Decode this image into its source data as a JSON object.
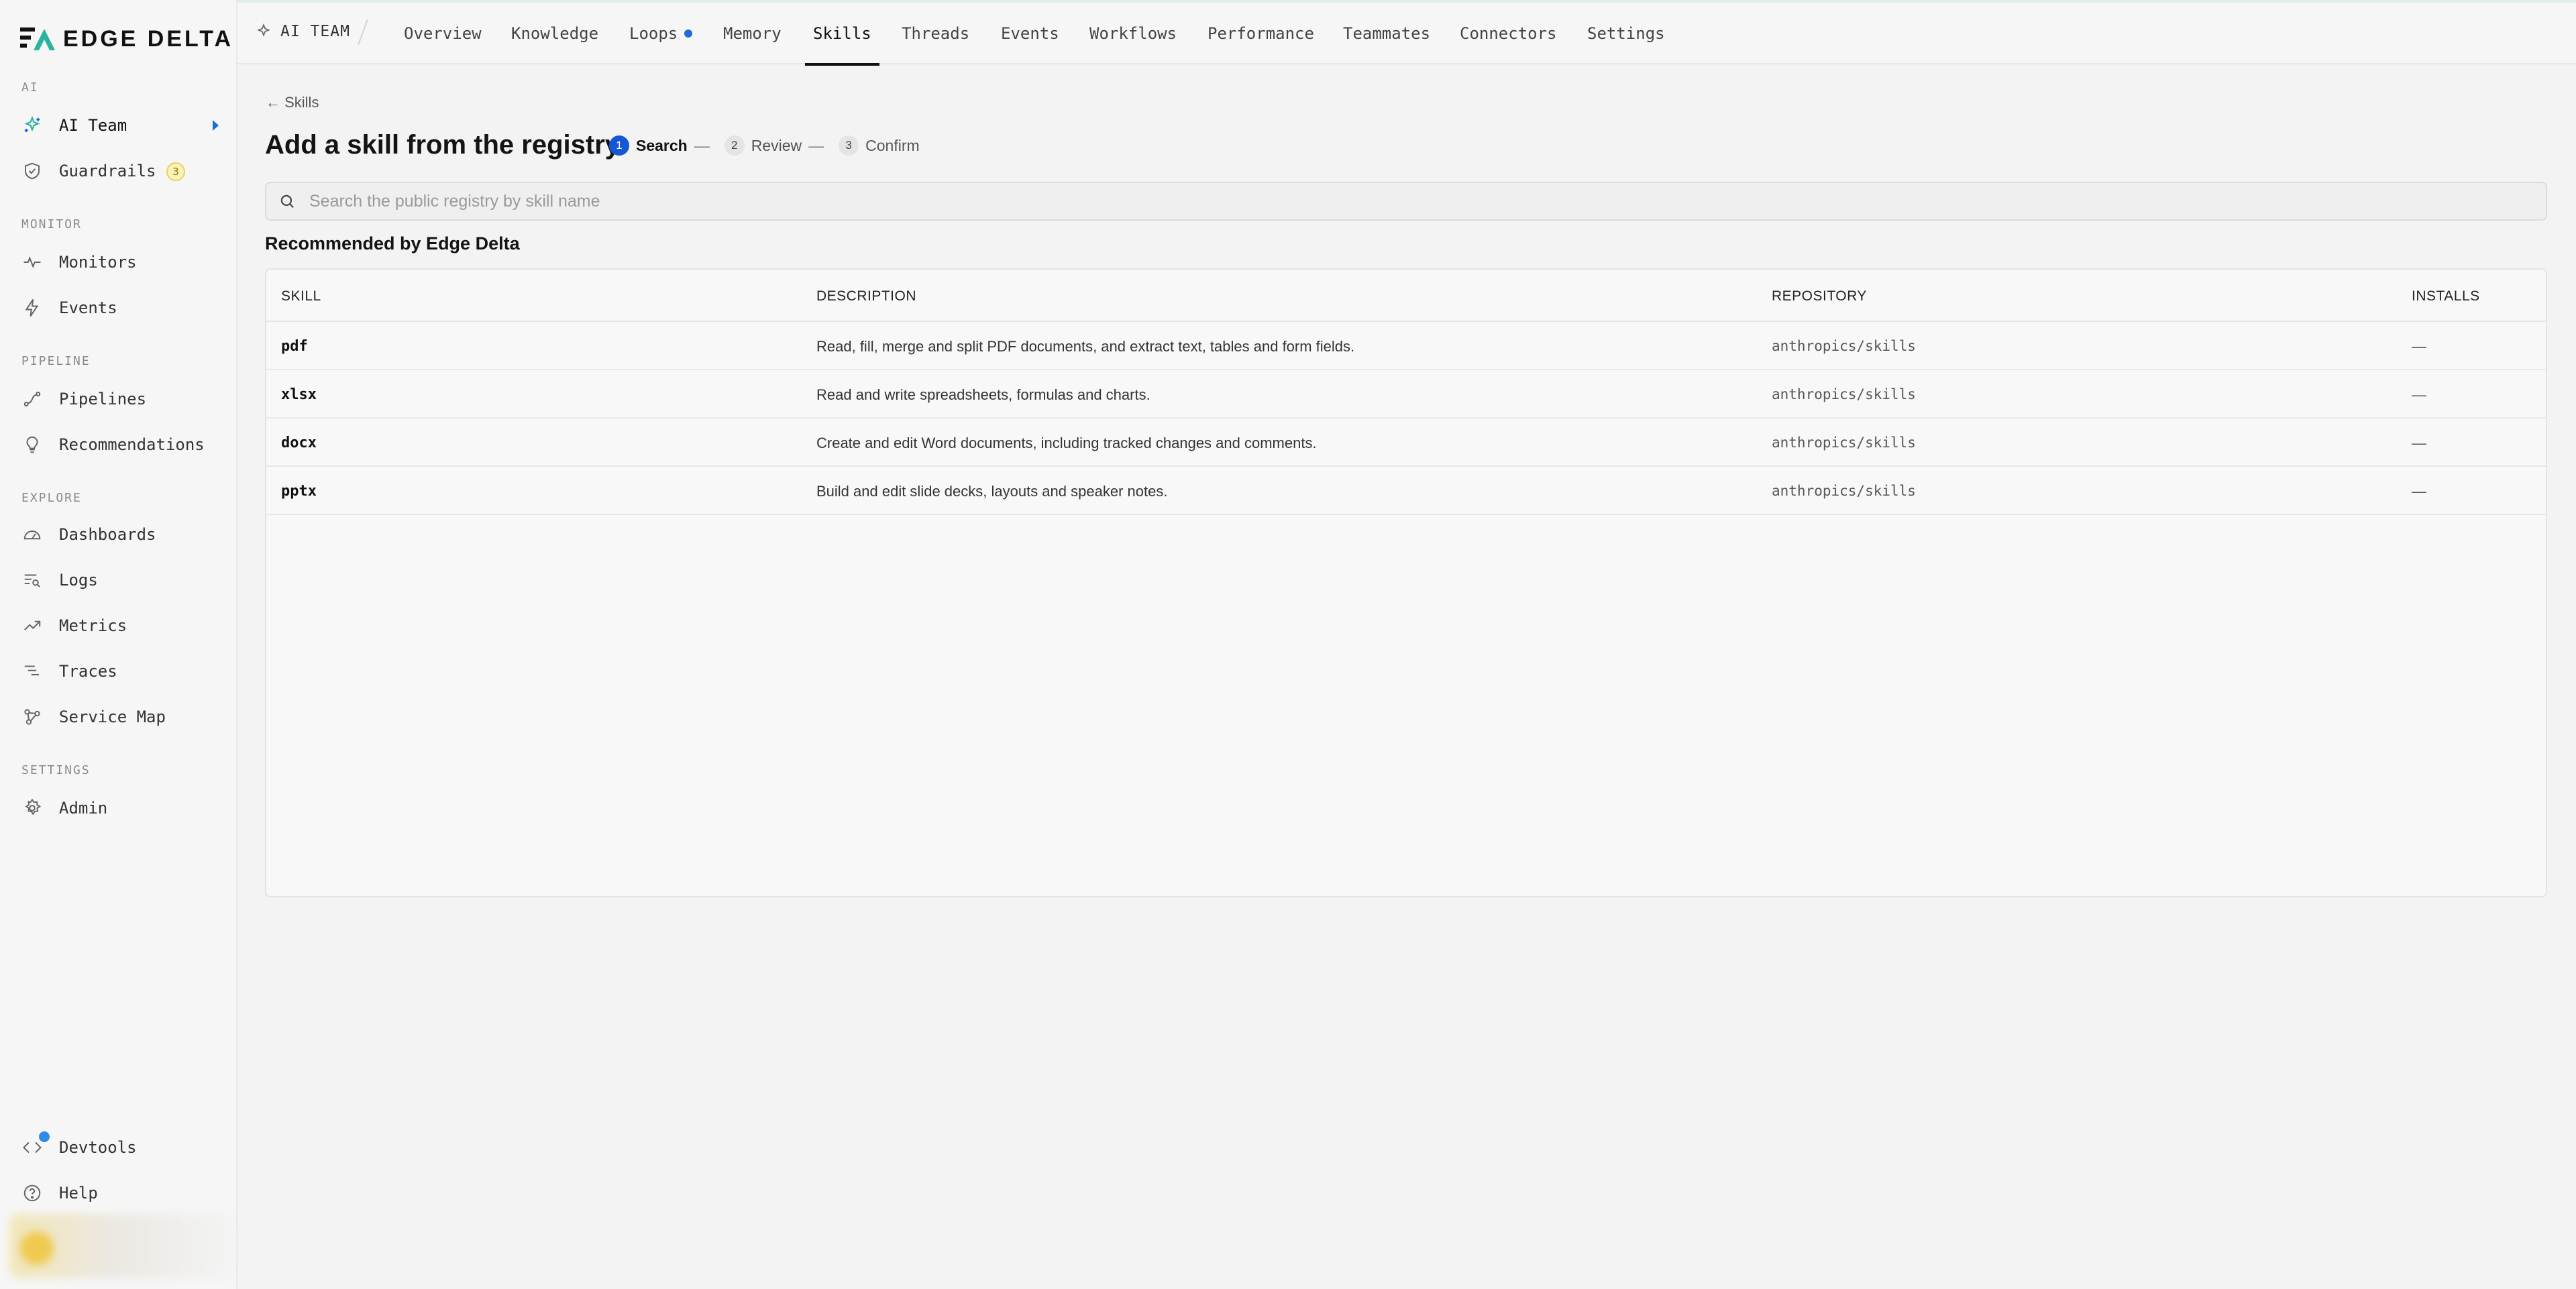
{
  "brand": {
    "name": "EDGE DELTA"
  },
  "sidebar": {
    "sections": [
      {
        "label": "AI"
      },
      {
        "label": "MONITOR"
      },
      {
        "label": "PIPELINE"
      },
      {
        "label": "EXPLORE"
      },
      {
        "label": "SETTINGS"
      }
    ],
    "items": [
      {
        "label": "AI Team",
        "icon": "sparkle-icon"
      },
      {
        "label": "Guardrails",
        "icon": "shield-check-icon",
        "badge": "3"
      },
      {
        "label": "Monitors",
        "icon": "pulse-icon"
      },
      {
        "label": "Events",
        "icon": "bolt-icon"
      },
      {
        "label": "Pipelines",
        "icon": "pipeline-icon"
      },
      {
        "label": "Recommendations",
        "icon": "lightbulb-icon"
      },
      {
        "label": "Dashboards",
        "icon": "gauge-icon"
      },
      {
        "label": "Logs",
        "icon": "logs-search-icon"
      },
      {
        "label": "Metrics",
        "icon": "trend-up-icon"
      },
      {
        "label": "Traces",
        "icon": "traces-icon"
      },
      {
        "label": "Service Map",
        "icon": "service-map-icon"
      },
      {
        "label": "Admin",
        "icon": "gear-icon"
      }
    ],
    "bottom": [
      {
        "label": "Devtools",
        "icon": "code-icon"
      },
      {
        "label": "Help",
        "icon": "help-circle-icon"
      }
    ]
  },
  "topbar": {
    "crumb": "AI TEAM",
    "tabs": [
      {
        "label": "Overview"
      },
      {
        "label": "Knowledge"
      },
      {
        "label": "Loops"
      },
      {
        "label": "Memory"
      },
      {
        "label": "Skills"
      },
      {
        "label": "Threads"
      },
      {
        "label": "Events"
      },
      {
        "label": "Workflows"
      },
      {
        "label": "Performance"
      },
      {
        "label": "Teammates"
      },
      {
        "label": "Connectors"
      },
      {
        "label": "Settings"
      }
    ],
    "active_tab": "Skills"
  },
  "page": {
    "back_label": "← Skills",
    "title": "Add a skill from the registry",
    "steps": [
      {
        "num": "1",
        "label": "Search"
      },
      {
        "num": "2",
        "label": "Review"
      },
      {
        "num": "3",
        "label": "Confirm"
      }
    ],
    "step_separator": "—",
    "search_placeholder": "Search the public registry by skill name",
    "section_title": "Recommended by Edge Delta"
  },
  "table": {
    "columns": [
      "SKILL",
      "DESCRIPTION",
      "REPOSITORY",
      "INSTALLS"
    ],
    "rows": [
      {
        "skill": "pdf",
        "description": "Read, fill, merge and split PDF documents, and extract text, tables and form fields.",
        "repository": "anthropics/skills",
        "installs": "—"
      },
      {
        "skill": "xlsx",
        "description": "Read and write spreadsheets, formulas and charts.",
        "repository": "anthropics/skills",
        "installs": "—"
      },
      {
        "skill": "docx",
        "description": "Create and edit Word documents, including tracked changes and comments.",
        "repository": "anthropics/skills",
        "installs": "—"
      },
      {
        "skill": "pptx",
        "description": "Build and edit slide decks, layouts and speaker notes.",
        "repository": "anthropics/skills",
        "installs": "—"
      }
    ]
  },
  "colors": {
    "accent": "#1558d6",
    "brand_teal": "#2bb3a0",
    "badge_yellow": "#fbf2b5"
  }
}
